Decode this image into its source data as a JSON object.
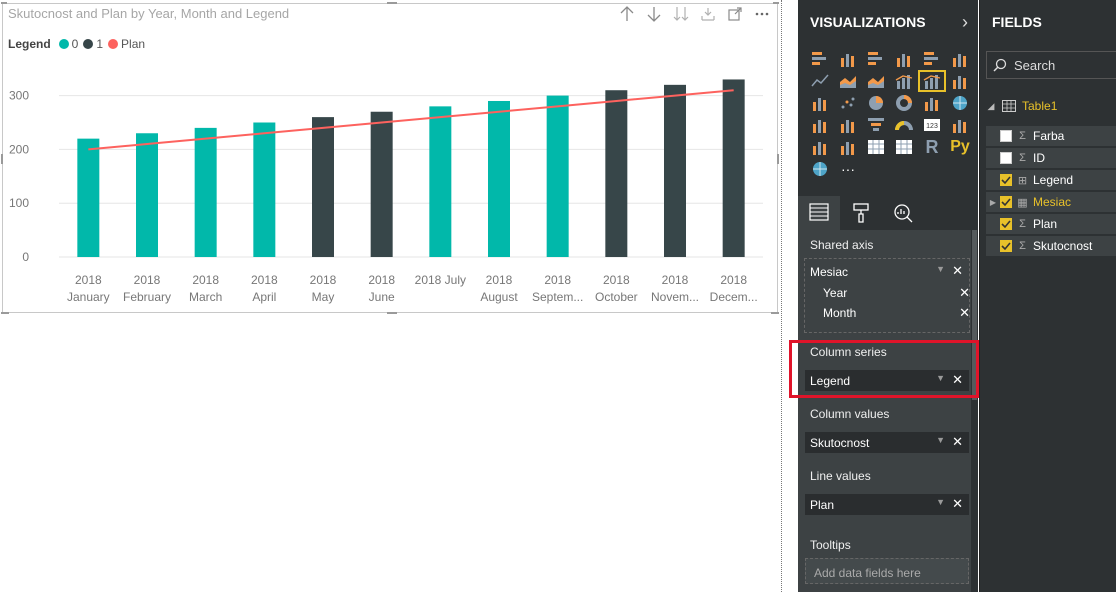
{
  "visual": {
    "title": "Skutocnost and Plan by Year, Month and Legend",
    "legend": {
      "title": "Legend",
      "items": [
        {
          "label": "0",
          "color": "#01b8aa"
        },
        {
          "label": "1",
          "color": "#374649"
        },
        {
          "label": "Plan",
          "color": "#fd625e"
        }
      ]
    },
    "header_icons": [
      "drill-up-icon",
      "drill-down-icon",
      "expand-all-icon",
      "expand-hierarchy-icon",
      "focus-mode-icon",
      "more-options-icon"
    ]
  },
  "chart_data": {
    "type": "bar",
    "combo_line": true,
    "categories": [
      [
        "2018",
        "January"
      ],
      [
        "2018",
        "February"
      ],
      [
        "2018",
        "March"
      ],
      [
        "2018",
        "April"
      ],
      [
        "2018",
        "May"
      ],
      [
        "2018",
        "June"
      ],
      [
        "2018 July",
        ""
      ],
      [
        "2018",
        "August"
      ],
      [
        "2018",
        "Septem..."
      ],
      [
        "2018",
        "October"
      ],
      [
        "2018",
        "Novem..."
      ],
      [
        "2018",
        "Decem..."
      ]
    ],
    "series": [
      {
        "name": "0",
        "type": "bar",
        "color": "#01b8aa",
        "values": [
          220,
          230,
          240,
          250,
          null,
          null,
          280,
          290,
          300,
          null,
          null,
          null
        ]
      },
      {
        "name": "1",
        "type": "bar",
        "color": "#374649",
        "values": [
          null,
          null,
          null,
          null,
          260,
          270,
          null,
          null,
          null,
          310,
          320,
          330
        ]
      },
      {
        "name": "Plan",
        "type": "line",
        "color": "#fd625e",
        "values": [
          200,
          210,
          220,
          230,
          240,
          250,
          260,
          270,
          280,
          290,
          300,
          310
        ]
      }
    ],
    "yticks": [
      0,
      100,
      200,
      300
    ],
    "ylim": [
      0,
      340
    ],
    "grid": true,
    "legend_position": "top-left"
  },
  "visualizations": {
    "title": "VISUALIZATIONS",
    "icons": [
      "stacked-bar-chart-icon",
      "stacked-column-chart-icon",
      "clustered-bar-chart-icon",
      "clustered-column-chart-icon",
      "100-stacked-bar-chart-icon",
      "100-stacked-column-chart-icon",
      "line-chart-icon",
      "area-chart-icon",
      "stacked-area-chart-icon",
      "line-and-stacked-column-chart-icon",
      "line-and-clustered-column-chart-icon",
      "ribbon-chart-icon",
      "waterfall-chart-icon",
      "scatter-chart-icon",
      "pie-chart-icon",
      "donut-chart-icon",
      "treemap-icon",
      "map-icon",
      "filled-map-icon",
      "shape-map-icon",
      "funnel-icon",
      "gauge-icon",
      "card-icon",
      "multi-row-card-icon",
      "kpi-icon",
      "slicer-icon",
      "table-icon",
      "matrix-icon",
      "r-visual-icon",
      "python-visual-icon",
      "arcgis-map-icon",
      "more-visuals-icon"
    ],
    "selected_icon": "line-and-clustered-column-chart-icon",
    "wells": {
      "shared_axis": {
        "label": "Shared axis",
        "field": "Mesiac",
        "sub_items": [
          "Year",
          "Month"
        ]
      },
      "column_series": {
        "label": "Column series",
        "field": "Legend"
      },
      "column_values": {
        "label": "Column values",
        "field": "Skutocnost"
      },
      "line_values": {
        "label": "Line values",
        "field": "Plan"
      },
      "tooltips": {
        "label": "Tooltips",
        "placeholder": "Add data fields here"
      }
    },
    "r_label": "R",
    "py_label": "Py",
    "more_label": "···"
  },
  "fields": {
    "title": "FIELDS",
    "search_placeholder": "Search",
    "table": "Table1",
    "items": [
      {
        "name": "Farba",
        "checked": false,
        "type": "sigma"
      },
      {
        "name": "ID",
        "checked": false,
        "type": "sigma"
      },
      {
        "name": "Legend",
        "checked": true,
        "type": "calc"
      },
      {
        "name": "Mesiac",
        "checked": true,
        "type": "hierarchy",
        "highlight": true
      },
      {
        "name": "Plan",
        "checked": true,
        "type": "sigma"
      },
      {
        "name": "Skutocnost",
        "checked": true,
        "type": "sigma"
      }
    ]
  }
}
